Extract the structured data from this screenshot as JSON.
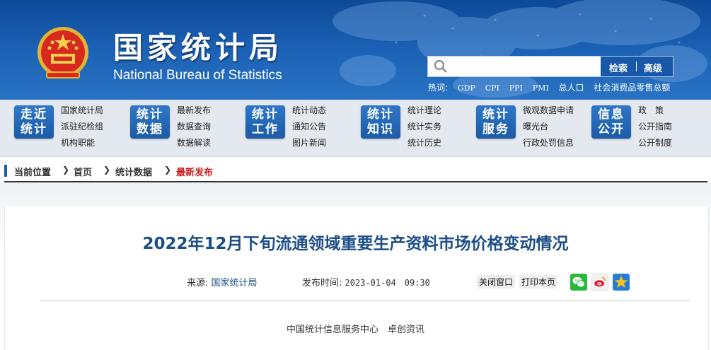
{
  "header": {
    "title_cn": "国家统计局",
    "title_en": "National Bureau of Statistics",
    "search": {
      "placeholder": "",
      "search_label": "检索",
      "advanced_label": "高级"
    },
    "hot_label": "热词:",
    "hot_words": [
      "GDP",
      "CPI",
      "PPI",
      "PMI",
      "总人口",
      "社会消费品零售总额"
    ]
  },
  "nav": [
    {
      "badge": [
        "走近",
        "统计"
      ],
      "links": [
        "国家统计局",
        "派驻纪检组",
        "机构职能"
      ]
    },
    {
      "badge": [
        "统计",
        "数据"
      ],
      "links": [
        "最新发布",
        "数据查询",
        "数据解读"
      ]
    },
    {
      "badge": [
        "统计",
        "工作"
      ],
      "links": [
        "统计动态",
        "通知公告",
        "图片新闻"
      ]
    },
    {
      "badge": [
        "统计",
        "知识"
      ],
      "links": [
        "统计理论",
        "统计实务",
        "统计历史"
      ]
    },
    {
      "badge": [
        "统计",
        "服务"
      ],
      "links": [
        "微观数据申请",
        "曝光台",
        "行政处罚信息"
      ]
    },
    {
      "badge": [
        "信息",
        "公开"
      ],
      "links": [
        "政　策",
        "公开指南",
        "公开制度"
      ]
    }
  ],
  "breadcrumb": {
    "current_label": "当前位置",
    "items": [
      "首页",
      "统计数据",
      "最新发布"
    ]
  },
  "article": {
    "title": "2022年12月下旬流通领域重要生产资料市场价格变动情况",
    "source_label": "来源:",
    "source": "国家统计局",
    "time_label": "发布时间:",
    "time": "2023-01-04　09:30",
    "close_label": "关闭窗口",
    "print_label": "打印本页",
    "byline": "中国统计信息服务中心　卓创资讯"
  },
  "colors": {
    "header_blue": "#1a5fb3",
    "title_blue": "#1c4e86",
    "active_crumb": "#c8191b"
  },
  "icons": [
    "national-emblem-icon",
    "search-icon",
    "wechat-icon",
    "weibo-icon",
    "qzone-icon",
    "chevron-right-icon"
  ]
}
